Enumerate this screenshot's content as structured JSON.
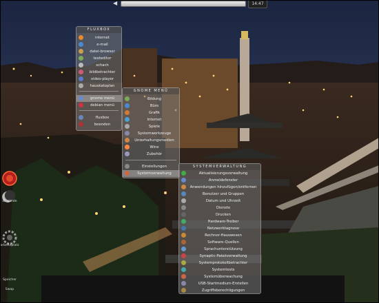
{
  "clock": "14:47",
  "fluxbox_menu": {
    "title": "FLUXBOX",
    "items": [
      "internet",
      "e-mail",
      "datei-browser",
      "texteditor",
      "schach",
      "bildbetrachter",
      "video-player",
      "hauskatoplan"
    ],
    "lower_items": [
      "gnome menü",
      "debian menü",
      "fluxbox",
      "beenden"
    ],
    "icon_colors": [
      "#e88a2a",
      "#4a8ad0",
      "#c9a04a",
      "#7aaa5a",
      "#bbbbbb",
      "#d05a7a",
      "#5a7ad0",
      "#aaaaaa",
      "#6a8acc",
      "#cc3344",
      "#6688bb",
      "#aa3333"
    ]
  },
  "gnome_menu": {
    "title": "GNOME MENÜ",
    "items": [
      "Bildung",
      "Büro",
      "Grafik",
      "Internet",
      "Spiele",
      "Systemwerkzeuge",
      "Unterhaltungsmedien",
      "Wine",
      "Zubehör"
    ],
    "lower_items": [
      "Einstellungen",
      "Systemverwaltung"
    ],
    "icon_colors": [
      "#7aaa5a",
      "#4a8ad0",
      "#d07a3a",
      "#4aa0d0",
      "#aaaaaa",
      "#8888aa",
      "#cc8844",
      "#ff8844",
      "#9999bb",
      "#888888",
      "#cc6644"
    ]
  },
  "system_menu": {
    "title": "SYSTEMVERWALTUNG",
    "items": [
      "Aktualisierungsverwaltung",
      "Anmeldefenster",
      "Anwendungen hinzufügen/entfernen",
      "Benutzer und Gruppen",
      "Datum und Uhrzeit",
      "Dienste",
      "Drucken",
      "Hardware-Treiber",
      "Netzwerktagnose",
      "Rechner-Hauswesen",
      "Software-Quellen",
      "Sprachunterstützung",
      "Synaptic-Paketverwaltung",
      "Systemprotokollbetrachter",
      "Systemtests",
      "Systemüberwachung",
      "USB-Startmedium-Erstellen",
      "Zugriffsberechtigungen"
    ],
    "icon_colors": [
      "#44aa44",
      "#6688cc",
      "#cc8844",
      "#5588bb",
      "#aaaaaa",
      "#888888",
      "#666666",
      "#44aa66",
      "#4477aa",
      "#cc8833",
      "#aa6633",
      "#6699cc",
      "#cc4444",
      "#aaaa44",
      "#44aaaa",
      "#cc6644",
      "#8888aa",
      "#aa8844"
    ]
  },
  "dock": {
    "items": [
      "zi. günde",
      "arbeitsplatz",
      "Speicher",
      "Swap"
    ]
  }
}
